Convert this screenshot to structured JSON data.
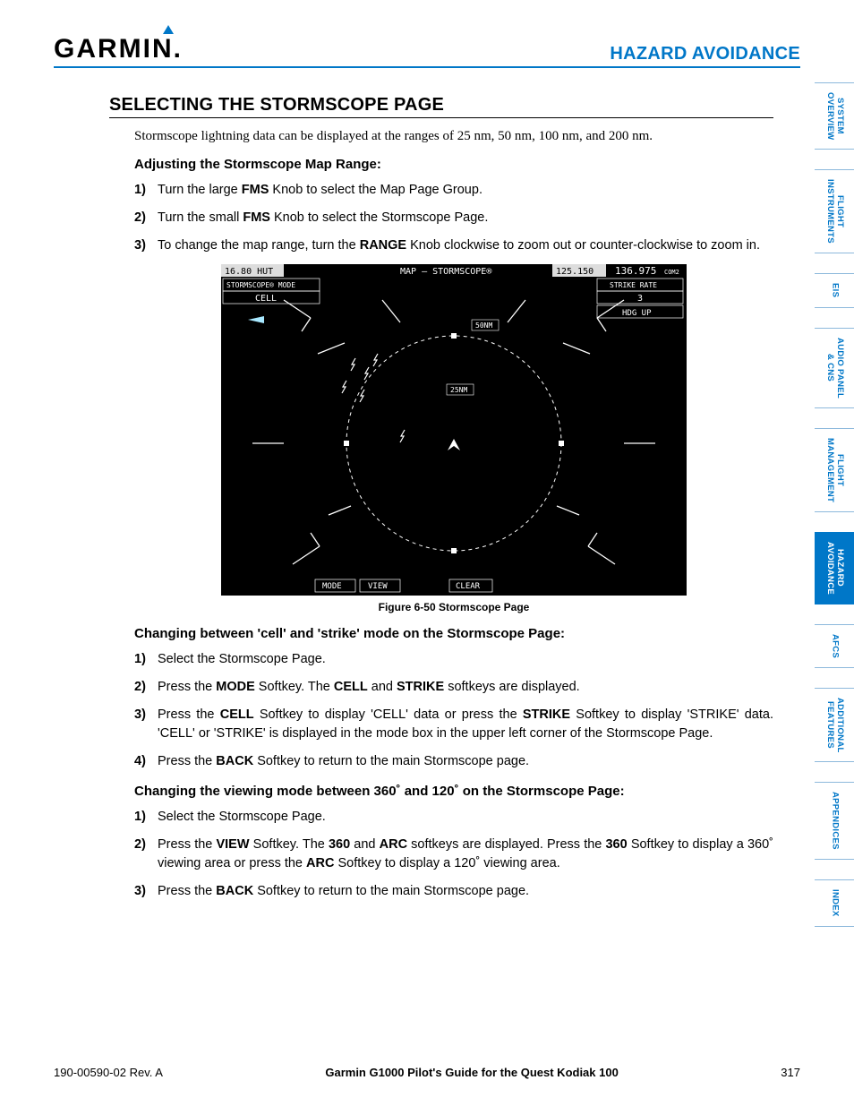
{
  "header": {
    "brand": "GARMIN",
    "title": "HAZARD AVOIDANCE"
  },
  "section_title": "SELECTING THE STORMSCOPE PAGE",
  "intro": "Stormscope lightning data can be displayed at the ranges of 25 nm, 50 nm, 100 nm, and 200 nm.",
  "sub1": {
    "title": "Adjusting the Stormscope Map Range:",
    "steps": [
      {
        "n": "1)",
        "pre": "Turn the large ",
        "b1": "FMS",
        "post": " Knob to select the Map Page Group."
      },
      {
        "n": "2)",
        "pre": "Turn the small ",
        "b1": "FMS",
        "post": " Knob to select the Stormscope Page."
      },
      {
        "n": "3)",
        "pre": "To change the map range, turn the ",
        "b1": "RANGE",
        "post": " Knob clockwise to zoom out or counter-clockwise to zoom in."
      }
    ]
  },
  "figure": {
    "caption": "Figure 6-50  Stormscope Page",
    "hut": "16.80 HUT",
    "map_title": "MAP – STORMSCOPE®",
    "com1": "125.150",
    "com2": "136.975",
    "com2_sub": "COM2",
    "mode_label": "STORMSCOPE® MODE",
    "mode_value": "CELL",
    "strike_label": "STRIKE RATE",
    "strike_value": "3",
    "hdg": "HDG UP",
    "range_inner": "25NM",
    "range_outer": "50NM",
    "softkeys": {
      "mode": "MODE",
      "view": "VIEW",
      "clear": "CLEAR"
    }
  },
  "sub2": {
    "title": "Changing between 'cell' and 'strike' mode on the Stormscope Page:",
    "s1": {
      "n": "1)",
      "txt": "Select the Stormscope Page."
    },
    "s2": {
      "n": "2)",
      "pre": "Press the ",
      "b1": "MODE",
      "mid": " Softkey.  The ",
      "b2": "CELL",
      "mid2": " and ",
      "b3": "STRIKE",
      "post": " softkeys are displayed."
    },
    "s3": {
      "n": "3)",
      "pre": "Press the ",
      "b1": "CELL",
      "mid": " Softkey to display 'CELL' data or press the ",
      "b2": "STRIKE",
      "post": " Softkey to display 'STRIKE' data.  'CELL' or 'STRIKE' is displayed in the mode box in the upper left corner of the Stormscope Page."
    },
    "s4": {
      "n": "4)",
      "pre": "Press the ",
      "b1": "BACK",
      "post": " Softkey to return to the main Stormscope page."
    }
  },
  "sub3": {
    "title": "Changing the viewing mode between 360˚ and 120˚ on the Stormscope Page:",
    "s1": {
      "n": "1)",
      "txt": "Select the Stormscope Page."
    },
    "s2": {
      "n": "2)",
      "pre": "Press the ",
      "b1": "VIEW",
      "mid": " Softkey.  The ",
      "b2": "360",
      "mid2": " and ",
      "b3": "ARC",
      "mid3": " softkeys are displayed.  Press the ",
      "b4": "360",
      "mid4": " Softkey to display a 360˚ viewing area or press the ",
      "b5": "ARC",
      "post": " Softkey to display a 120˚ viewing area."
    },
    "s3": {
      "n": "3)",
      "pre": "Press the ",
      "b1": "BACK",
      "post": " Softkey to return to the main Stormscope page."
    }
  },
  "footer": {
    "left": "190-00590-02  Rev. A",
    "center": "Garmin G1000 Pilot's Guide for the Quest Kodiak 100",
    "right": "317"
  },
  "tabs": [
    {
      "label": "SYSTEM\nOVERVIEW",
      "active": false
    },
    {
      "label": "FLIGHT\nINSTRUMENTS",
      "active": false
    },
    {
      "label": "EIS",
      "active": false
    },
    {
      "label": "AUDIO PANEL\n& CNS",
      "active": false
    },
    {
      "label": "FLIGHT\nMANAGEMENT",
      "active": false
    },
    {
      "label": "HAZARD\nAVOIDANCE",
      "active": true
    },
    {
      "label": "AFCS",
      "active": false
    },
    {
      "label": "ADDITIONAL\nFEATURES",
      "active": false
    },
    {
      "label": "APPENDICES",
      "active": false
    },
    {
      "label": "INDEX",
      "active": false
    }
  ]
}
